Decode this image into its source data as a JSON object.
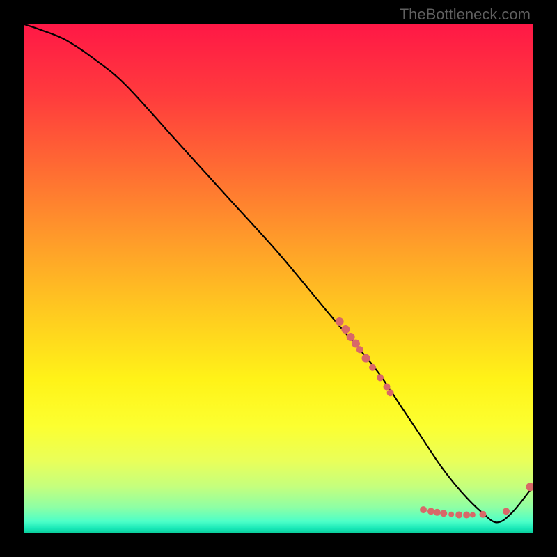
{
  "attribution": "TheBottleneck.com",
  "gradient": {
    "stops": [
      {
        "offset": 0.0,
        "color": "#ff1846"
      },
      {
        "offset": 0.14,
        "color": "#ff3b3d"
      },
      {
        "offset": 0.28,
        "color": "#ff6a33"
      },
      {
        "offset": 0.42,
        "color": "#ff9a2a"
      },
      {
        "offset": 0.56,
        "color": "#ffc820"
      },
      {
        "offset": 0.7,
        "color": "#fff318"
      },
      {
        "offset": 0.79,
        "color": "#fcff30"
      },
      {
        "offset": 0.86,
        "color": "#e9ff5a"
      },
      {
        "offset": 0.91,
        "color": "#c4ff7e"
      },
      {
        "offset": 0.95,
        "color": "#8effa4"
      },
      {
        "offset": 0.978,
        "color": "#4dffc8"
      },
      {
        "offset": 0.992,
        "color": "#18e8b8"
      },
      {
        "offset": 1.0,
        "color": "#0bcf9c"
      }
    ]
  },
  "chart_data": {
    "type": "line",
    "title": "",
    "xlabel": "",
    "ylabel": "",
    "xlim": [
      0,
      100
    ],
    "ylim": [
      0,
      100
    ],
    "series": [
      {
        "name": "curve",
        "x": [
          0,
          3,
          8,
          14,
          20,
          30,
          40,
          50,
          60,
          66,
          70,
          74,
          78,
          82,
          86,
          90,
          93,
          96,
          100
        ],
        "y": [
          100,
          99,
          97,
          93,
          88,
          77,
          66,
          55,
          43,
          36,
          31,
          25,
          19,
          13,
          8,
          4,
          2,
          4,
          9
        ]
      }
    ],
    "markers": {
      "name": "highlight-points",
      "color": "#d86868",
      "points": [
        {
          "x": 62.0,
          "y": 41.5,
          "r": 6
        },
        {
          "x": 63.2,
          "y": 40.0,
          "r": 6
        },
        {
          "x": 64.2,
          "y": 38.5,
          "r": 6
        },
        {
          "x": 65.2,
          "y": 37.2,
          "r": 6
        },
        {
          "x": 66.0,
          "y": 36.0,
          "r": 5
        },
        {
          "x": 67.2,
          "y": 34.3,
          "r": 6
        },
        {
          "x": 68.5,
          "y": 32.5,
          "r": 5
        },
        {
          "x": 70.0,
          "y": 30.5,
          "r": 5
        },
        {
          "x": 71.3,
          "y": 28.7,
          "r": 5
        },
        {
          "x": 72.0,
          "y": 27.5,
          "r": 5
        },
        {
          "x": 78.5,
          "y": 4.5,
          "r": 5
        },
        {
          "x": 80.0,
          "y": 4.2,
          "r": 5
        },
        {
          "x": 81.2,
          "y": 4.0,
          "r": 5
        },
        {
          "x": 82.5,
          "y": 3.8,
          "r": 5
        },
        {
          "x": 84.0,
          "y": 3.6,
          "r": 4
        },
        {
          "x": 85.5,
          "y": 3.5,
          "r": 5
        },
        {
          "x": 87.0,
          "y": 3.5,
          "r": 5
        },
        {
          "x": 88.2,
          "y": 3.5,
          "r": 4
        },
        {
          "x": 90.2,
          "y": 3.6,
          "r": 5
        },
        {
          "x": 94.8,
          "y": 4.2,
          "r": 5
        },
        {
          "x": 99.5,
          "y": 9.0,
          "r": 6
        }
      ]
    }
  }
}
